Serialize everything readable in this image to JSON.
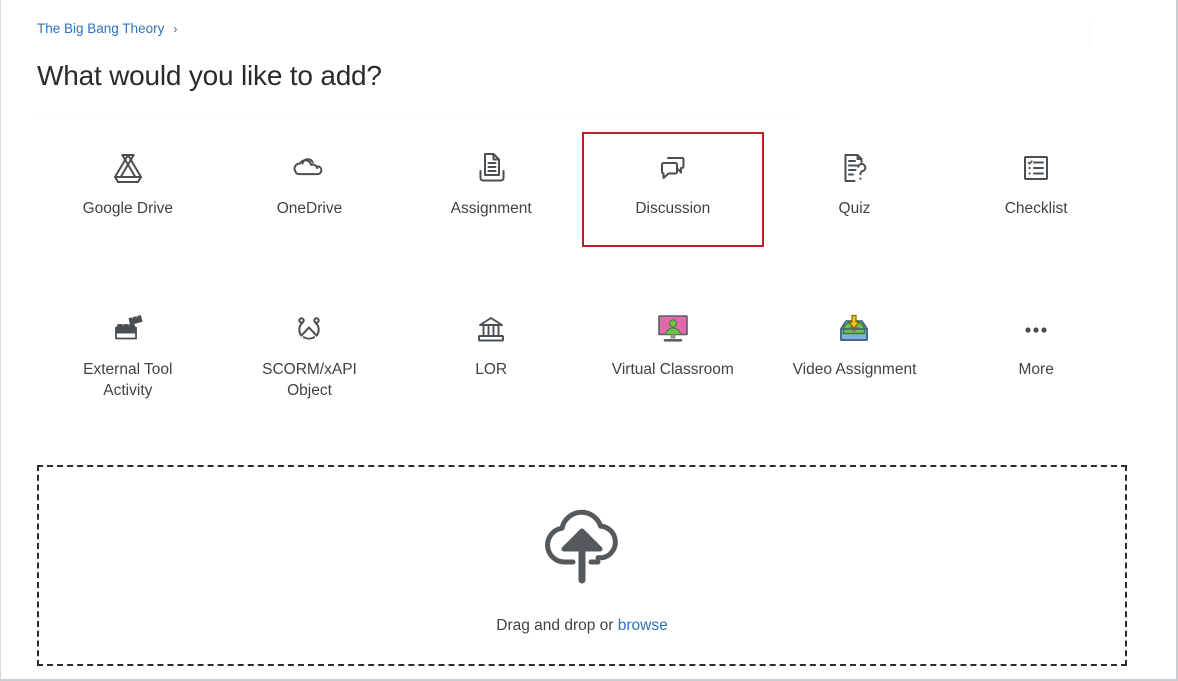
{
  "breadcrumb": {
    "course": "The Big Bang Theory",
    "separator": "›",
    "icon": "chevron-right-icon"
  },
  "page_title": "What would you like to add?",
  "colors": {
    "link": "#2d73b8",
    "selection_outline": "#c21d26",
    "icon_stroke": "#4a4f53",
    "text": "#3f4346"
  },
  "tiles": {
    "row1": [
      {
        "label": "Google Drive",
        "icon": "google-drive-icon",
        "selected": false
      },
      {
        "label": "OneDrive",
        "icon": "onedrive-cloud-icon",
        "selected": false
      },
      {
        "label": "Assignment",
        "icon": "assignment-document-icon",
        "selected": false
      },
      {
        "label": "Discussion",
        "icon": "discussion-speech-bubbles-icon",
        "selected": true
      },
      {
        "label": "Quiz",
        "icon": "quiz-question-document-icon",
        "selected": false
      },
      {
        "label": "Checklist",
        "icon": "checklist-icon",
        "selected": false
      }
    ],
    "row2": [
      {
        "label": "External Tool Activity",
        "icon": "external-tool-bricks-icon",
        "selected": false
      },
      {
        "label": "SCORM/xAPI Object",
        "icon": "scorm-xapi-icon",
        "selected": false
      },
      {
        "label": "LOR",
        "icon": "learning-object-repository-bank-icon",
        "selected": false
      },
      {
        "label": "Virtual Classroom",
        "icon": "virtual-classroom-monitor-icon",
        "selected": false
      },
      {
        "label": "Video Assignment",
        "icon": "video-assignment-inbox-icon",
        "selected": false
      },
      {
        "label": "More",
        "icon": "more-ellipsis-icon",
        "selected": false
      }
    ]
  },
  "dropzone": {
    "icon": "cloud-upload-icon",
    "text_prefix": "Drag and drop or ",
    "browse_label": "browse"
  }
}
